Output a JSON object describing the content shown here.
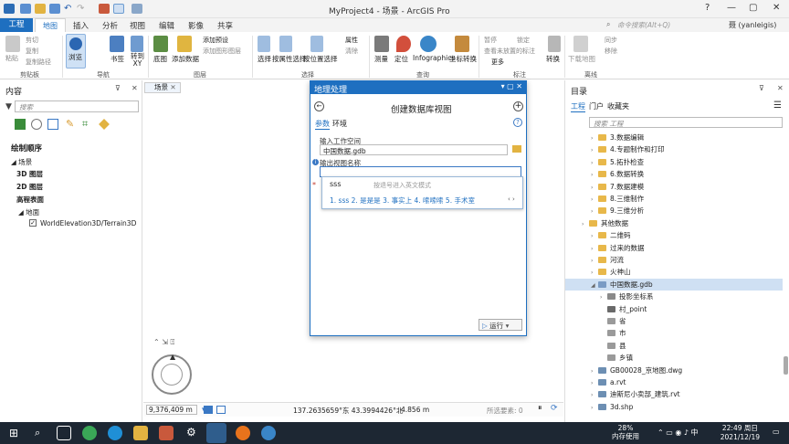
{
  "window": {
    "title": "MyProject4 - 场景 - ArcGIS Pro",
    "help": "?",
    "minimize": "—",
    "restore": "▢",
    "close": "✕"
  },
  "ribbon_tabs": [
    "工程",
    "地图",
    "插入",
    "分析",
    "视图",
    "编辑",
    "影像",
    "共享"
  ],
  "command_search": {
    "placeholder": "命令搜索(Alt+Q)"
  },
  "user": {
    "name": "聂 (yanleigis)"
  },
  "ribbon": {
    "clipboard": {
      "paste": "粘贴",
      "cut": "剪切",
      "copy": "复制",
      "copy_path": "复制路径",
      "group": "剪贴板"
    },
    "navigate": {
      "explore": "浏览",
      "bookmarks": "书签",
      "goto": "转到\nXY",
      "group": "导航"
    },
    "layer": {
      "basemap": "底图",
      "add_data": "添加数据",
      "add_preset": "添加预设",
      "add_graphics_layer": "添加图形图层",
      "group": "图层"
    },
    "selection": {
      "select": "选择",
      "select_by_attr": "按属性选择",
      "select_by_location": "按位置选择",
      "attributes": "属性",
      "clear": "清除",
      "group": "选择"
    },
    "inquiry": {
      "measure": "测量",
      "locate": "定位",
      "infographics": "Infographics",
      "convert_coords": "坐标转换",
      "group": "查询"
    },
    "labeling": {
      "pause": "暂停",
      "lock": "锁定",
      "view_unplaced": "查看未放置的标注",
      "more": "更多",
      "group": "标注"
    },
    "convert": {
      "label": "转换"
    },
    "offline": {
      "download_map": "下载地图",
      "sync": "同步",
      "remove": "移除",
      "group": "离线"
    }
  },
  "contents": {
    "title": "内容",
    "search_placeholder": "搜索",
    "drawing_order": "绘制顺序",
    "items": [
      "场景",
      "3D 图层",
      "2D 图层",
      "高程表面",
      "地面",
      "WorldElevation3D/Terrain3D"
    ]
  },
  "scene_tab": {
    "label": "场景"
  },
  "status": {
    "scale": "9,376,409 m",
    "coords": "137.2635659°东 43.3994426°北",
    "elev": "4.856 m",
    "selected": "所选要素: 0"
  },
  "gp": {
    "title": "地理处理",
    "tool_name": "创建数据库视图",
    "tab_params": "参数",
    "tab_env": "环境",
    "input_workspace_label": "输入工作空间",
    "input_workspace_value": "中国数据.gdb",
    "output_view_label": "输出视图名称",
    "run": "运行"
  },
  "ime": {
    "composition": "sss",
    "hint": "按退号进入英文模式",
    "candidates": "1. sss  2. 是是是  3. 事实上  4. 嗦嗦嗦  5. 手术室"
  },
  "catalog": {
    "title": "目录",
    "tabs": [
      "工程",
      "门户",
      "收藏夹"
    ],
    "search_placeholder": "搜索 工程",
    "items": [
      {
        "label": "3.数据编辑",
        "level": 3,
        "kind": "folder"
      },
      {
        "label": "4.专题制作和打印",
        "level": 3,
        "kind": "folder"
      },
      {
        "label": "5.拓扑检查",
        "level": 3,
        "kind": "folder"
      },
      {
        "label": "6.数据转换",
        "level": 3,
        "kind": "folder"
      },
      {
        "label": "7.数据建模",
        "level": 3,
        "kind": "folder"
      },
      {
        "label": "8.三维制作",
        "level": 3,
        "kind": "folder"
      },
      {
        "label": "9.三维分析",
        "level": 3,
        "kind": "folder"
      },
      {
        "label": "其他数据",
        "level": 2,
        "kind": "folder"
      },
      {
        "label": "二维码",
        "level": 3,
        "kind": "folder"
      },
      {
        "label": "过来的数据",
        "level": 3,
        "kind": "folder"
      },
      {
        "label": "河流",
        "level": 3,
        "kind": "folder"
      },
      {
        "label": "火神山",
        "level": 3,
        "kind": "folder"
      },
      {
        "label": "中国数据.gdb",
        "level": 3,
        "kind": "gdb",
        "selected": true
      },
      {
        "label": "投影坐标系",
        "level": 4,
        "kind": "dataset"
      },
      {
        "label": "村_point",
        "level": 4,
        "kind": "point"
      },
      {
        "label": "省",
        "level": 4,
        "kind": "poly"
      },
      {
        "label": "市",
        "level": 4,
        "kind": "poly"
      },
      {
        "label": "县",
        "level": 4,
        "kind": "poly"
      },
      {
        "label": "乡镇",
        "level": 4,
        "kind": "poly"
      },
      {
        "label": "GB00028_京地图.dwg",
        "level": 3,
        "kind": "file"
      },
      {
        "label": "a.rvt",
        "level": 3,
        "kind": "file"
      },
      {
        "label": "迪斯尼小卖部_建筑.rvt",
        "level": 3,
        "kind": "file"
      },
      {
        "label": "3d.shp",
        "level": 3,
        "kind": "file"
      }
    ]
  },
  "taskbar": {
    "mem_pct": "28%",
    "mem_label": "内存使用",
    "time": "22:49 周日",
    "date": "2021/12/19"
  }
}
